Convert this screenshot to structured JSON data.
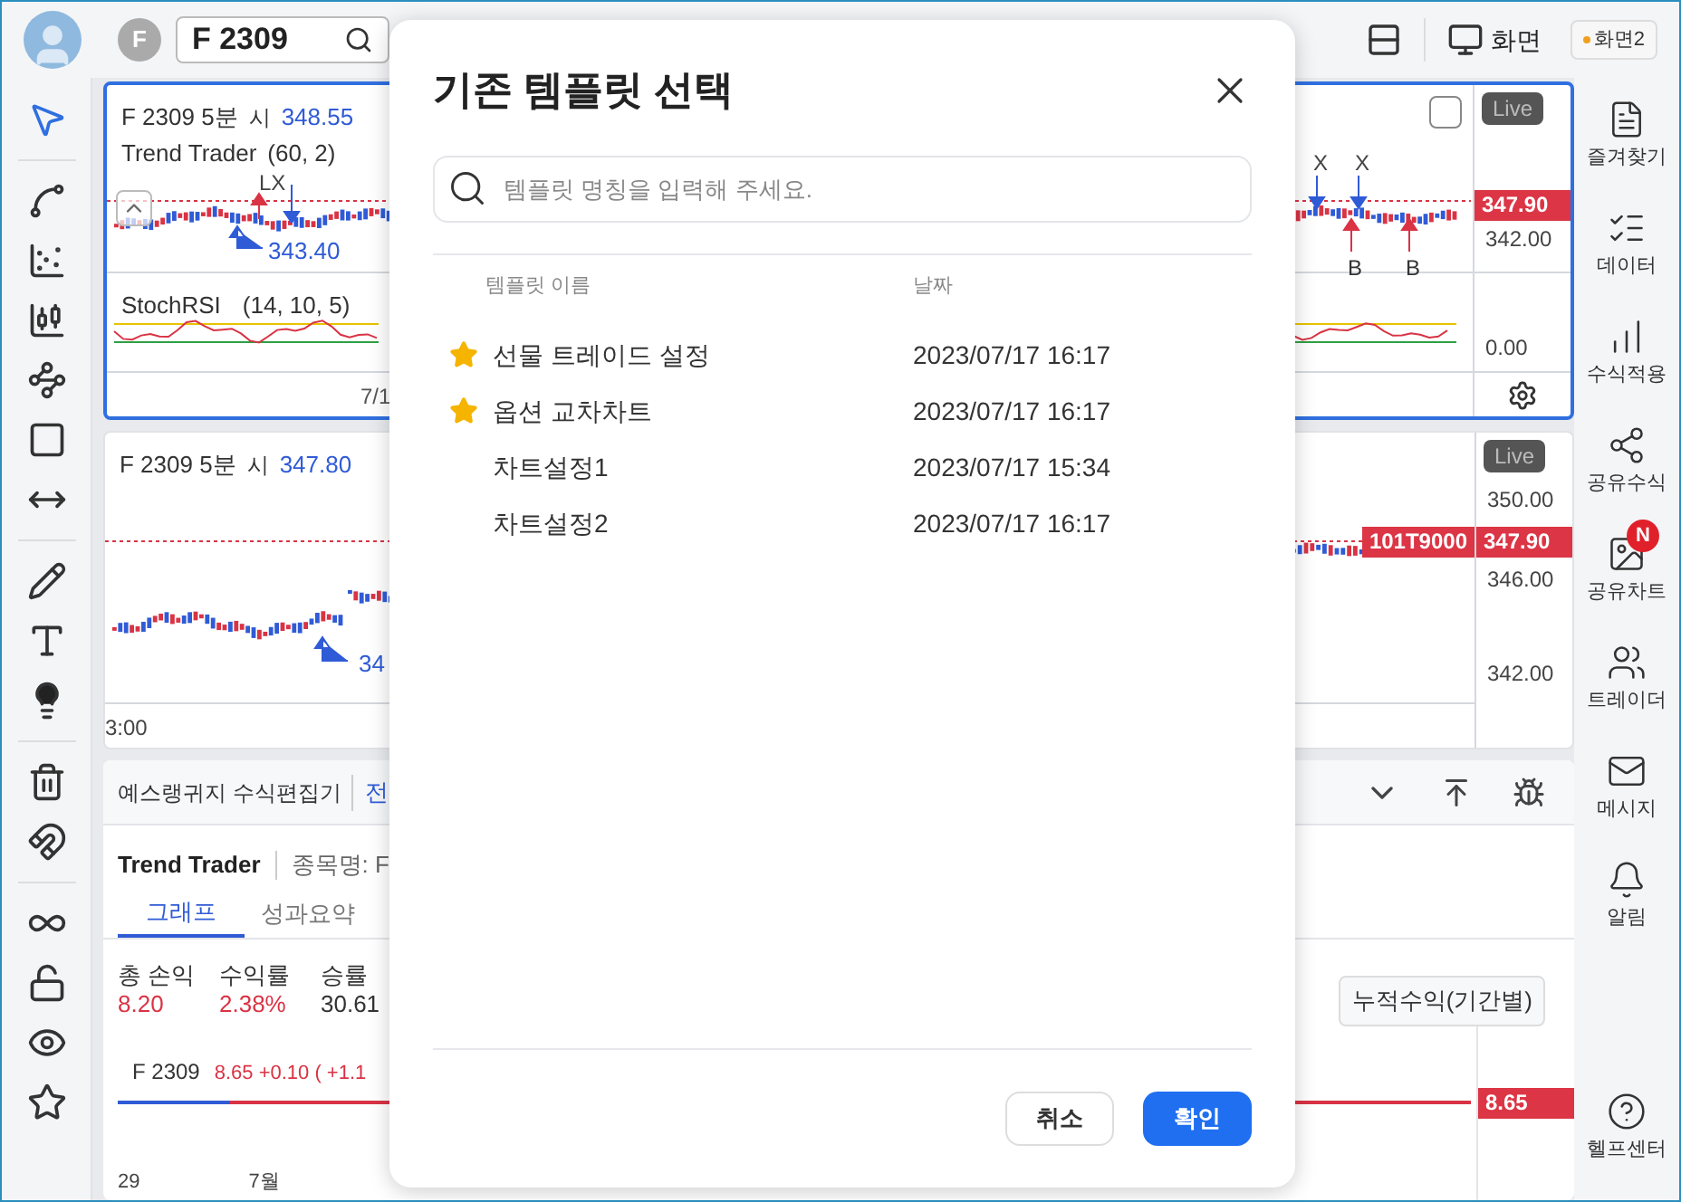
{
  "top_bar": {
    "symbol_initial": "F",
    "symbol": "F 2309",
    "screen_label": "화면",
    "screen_chip": "화면2"
  },
  "chart_panes": [
    {
      "selected": true,
      "title": "F 2309 5분",
      "open_label": "시",
      "open_value": "348.55",
      "strategy": "Trend Trader",
      "strategy_params": "(60, 2)",
      "marker_price": "343.40",
      "indicator": "StochRSI",
      "indicator_params": "(14, 10, 5)",
      "time_label": "7/1",
      "live": "Live",
      "last_price": "347.90",
      "price_ticks": [
        "342.00"
      ],
      "indicator_tick": "0.00",
      "signals": [
        {
          "label": "LX",
          "kind": "exit"
        },
        {
          "label": "X",
          "kind": "exit"
        },
        {
          "label": "X",
          "kind": "exit"
        },
        {
          "label": "B",
          "kind": "buy"
        },
        {
          "label": "B",
          "kind": "buy"
        }
      ]
    },
    {
      "selected": false,
      "title": "F 2309 5분",
      "open_label": "시",
      "open_value": "347.80",
      "marker_price": "34",
      "time_label": "3:00",
      "live": "Live",
      "symbol_tag": "101T9000",
      "last_price": "347.90",
      "price_ticks": [
        "350.00",
        "346.00",
        "342.00"
      ]
    }
  ],
  "editor": {
    "title": "예스랭귀지 수식편집기",
    "link": "전",
    "strategy": "Trend Trader",
    "symbol_label": "종목명: F",
    "tabs": [
      {
        "label": "그래프",
        "selected": true
      },
      {
        "label": "성과요약",
        "selected": false
      }
    ],
    "stats": [
      {
        "label": "총 손익",
        "value": "8.20",
        "color": "#d93344"
      },
      {
        "label": "수익률",
        "value": "2.38%",
        "color": "#d93344"
      },
      {
        "label": "승률",
        "value": "30.61",
        "color": "#333333"
      }
    ],
    "period_select": "누적수익(기간별)",
    "mini_symbol": "F 2309",
    "mini_quote": "8.65 +0.10 ( +1.1",
    "mini_last": "8.65",
    "mini_axis": [
      "29",
      "7월"
    ]
  },
  "sidebar": {
    "items": [
      {
        "label": "즐겨찾기",
        "kind": "favorites"
      },
      {
        "label": "데이터",
        "kind": "data"
      },
      {
        "label": "수식적용",
        "kind": "apply"
      },
      {
        "label": "공유수식",
        "kind": "share"
      },
      {
        "label": "공유차트",
        "kind": "shared-chart",
        "badge": "N"
      },
      {
        "label": "트레이더",
        "kind": "traders"
      },
      {
        "label": "메시지",
        "kind": "message"
      },
      {
        "label": "알림",
        "kind": "alert"
      },
      {
        "label": "헬프센터",
        "kind": "help"
      }
    ]
  },
  "dialog": {
    "title": "기존 템플릿 선택",
    "search": {
      "placeholder": "템플릿 명칭을 입력해 주세요."
    },
    "columns": [
      "템플릿 이름",
      "날짜"
    ],
    "templates": [
      {
        "name": "선물 트레이드 설정",
        "date": "2023/07/17 16:17",
        "favorite": true
      },
      {
        "name": "옵션 교차차트",
        "date": "2023/07/17 16:17",
        "favorite": true
      },
      {
        "name": "차트설정1",
        "date": "2023/07/17 15:34",
        "favorite": false
      },
      {
        "name": "차트설정2",
        "date": "2023/07/17 16:17",
        "favorite": false
      }
    ],
    "buttons": [
      {
        "label": "취소",
        "kind": "secondary"
      },
      {
        "label": "확인",
        "kind": "primary"
      }
    ]
  }
}
